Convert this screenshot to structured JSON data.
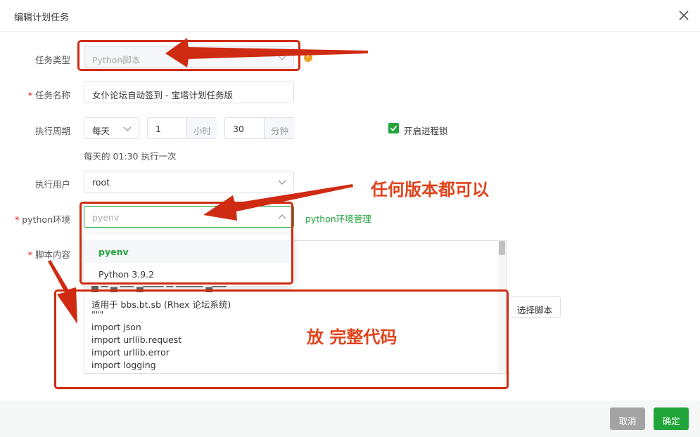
{
  "dialog": {
    "title": "编辑计划任务"
  },
  "form": {
    "task_type": {
      "label": "任务类型",
      "value": "Python脚本",
      "help_icon": "question-circle-icon"
    },
    "task_name": {
      "label": "任务名称",
      "required_mark": "*",
      "value": "女仆论坛自动签到 - 宝塔计划任务版"
    },
    "period": {
      "label": "执行周期",
      "frequency": "每天",
      "hour_value": "1",
      "hour_unit": "小时",
      "minute_value": "30",
      "minute_unit": "分钟",
      "hint": "每天的 01:30 执行一次",
      "process_lock_label": "开启进程锁",
      "process_lock_checked": true
    },
    "user": {
      "label": "执行用户",
      "value": "root"
    },
    "python_env": {
      "label": "python环境",
      "required_mark": "*",
      "value": "pyenv",
      "manage_link": "python环境管理",
      "options": [
        {
          "label": "pyenv",
          "selected": true
        },
        {
          "label": "Python 3.9.2",
          "selected": false
        }
      ]
    },
    "script": {
      "label": "脚本内容",
      "required_mark": "*",
      "code_lines": [
        "适用于 bbs.bt.sb (Rhex 论坛系统)",
        "\"\"\"",
        "import json",
        "import urllib.request",
        "import urllib.error",
        "import logging"
      ],
      "select_button": "选择脚本"
    }
  },
  "footer": {
    "cancel": "取消",
    "confirm": "确定"
  },
  "annotations": {
    "any_version": "任何版本都可以",
    "full_code": "放 完整代码",
    "color": "#cf2b12"
  },
  "colors": {
    "brand_green": "#20a53a",
    "cancel_gray": "#a3a3a3",
    "required_red": "#ef0808"
  }
}
